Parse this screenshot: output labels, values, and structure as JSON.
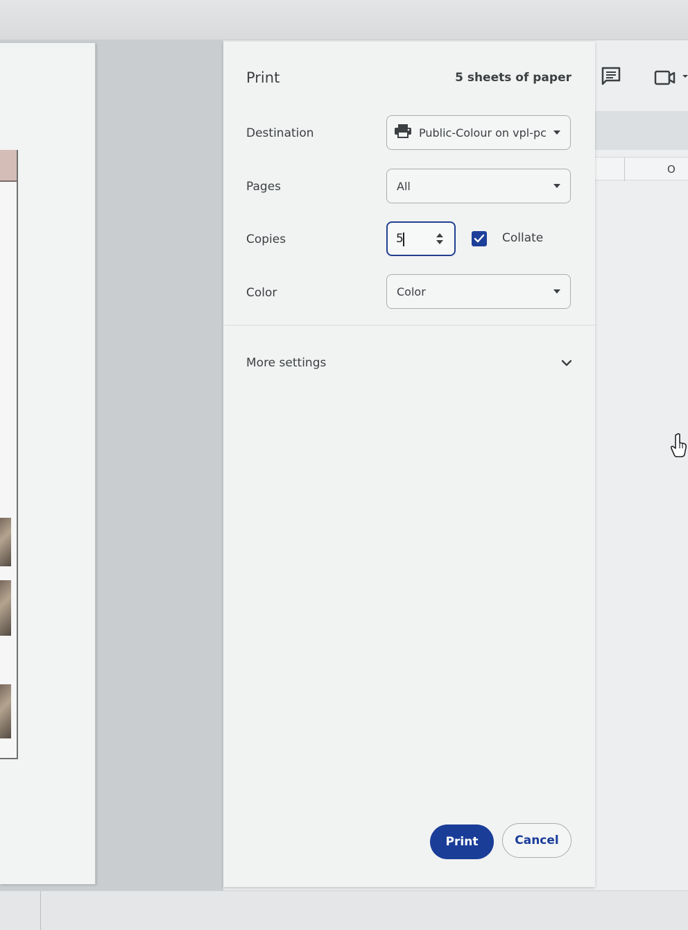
{
  "dialog": {
    "title": "Print",
    "sheet_count": "5 sheets of paper",
    "destination": {
      "label": "Destination",
      "value": "Public-Colour on vpl-pc",
      "icon": "printer-icon"
    },
    "pages": {
      "label": "Pages",
      "value": "All"
    },
    "copies": {
      "label": "Copies",
      "value": "5",
      "collate_label": "Collate",
      "collate_checked": true
    },
    "color": {
      "label": "Color",
      "value": "Color"
    },
    "more_settings_label": "More settings",
    "print_label": "Print",
    "cancel_label": "Cancel",
    "accent_color": "#1a3d98"
  },
  "background": {
    "column_label": "O",
    "icons": [
      "comment-icon",
      "camera-icon",
      "hand-cursor-icon"
    ]
  }
}
